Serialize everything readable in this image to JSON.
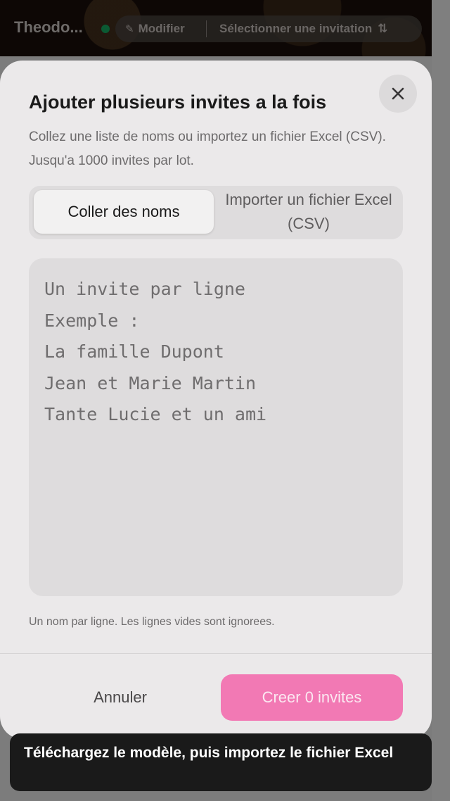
{
  "header": {
    "event_name": "Theodo...",
    "edit_label": "Modifier",
    "select_label": "Sélectionner une invitation",
    "icons": {
      "edit": "pencil-icon",
      "sort": "sort-arrows-icon",
      "status": "status-dot"
    },
    "status_color": "#0b5a33"
  },
  "modal": {
    "title": "Ajouter plusieurs invites a la fois",
    "description": "Collez une liste de noms ou importez un fichier Excel (CSV). Jusqu'a 1000 invites par lot.",
    "close_icon": "close-icon",
    "tabs": [
      {
        "label": "Coller des noms",
        "active": true
      },
      {
        "label": "Importer un fichier Excel (CSV)",
        "active": false
      }
    ],
    "textarea": {
      "placeholder": "Un invite par ligne\nExemple :\nLa famille Dupont\nJean et Marie Martin\nTante Lucie et un ami",
      "value": ""
    },
    "hint": "Un nom par ligne. Les lignes vides sont ignorees.",
    "cancel_label": "Annuler",
    "create_label": "Creer 0 invites",
    "accent_color": "#f279b4"
  },
  "toast": {
    "message": "Téléchargez le modèle, puis importez le fichier Excel"
  }
}
